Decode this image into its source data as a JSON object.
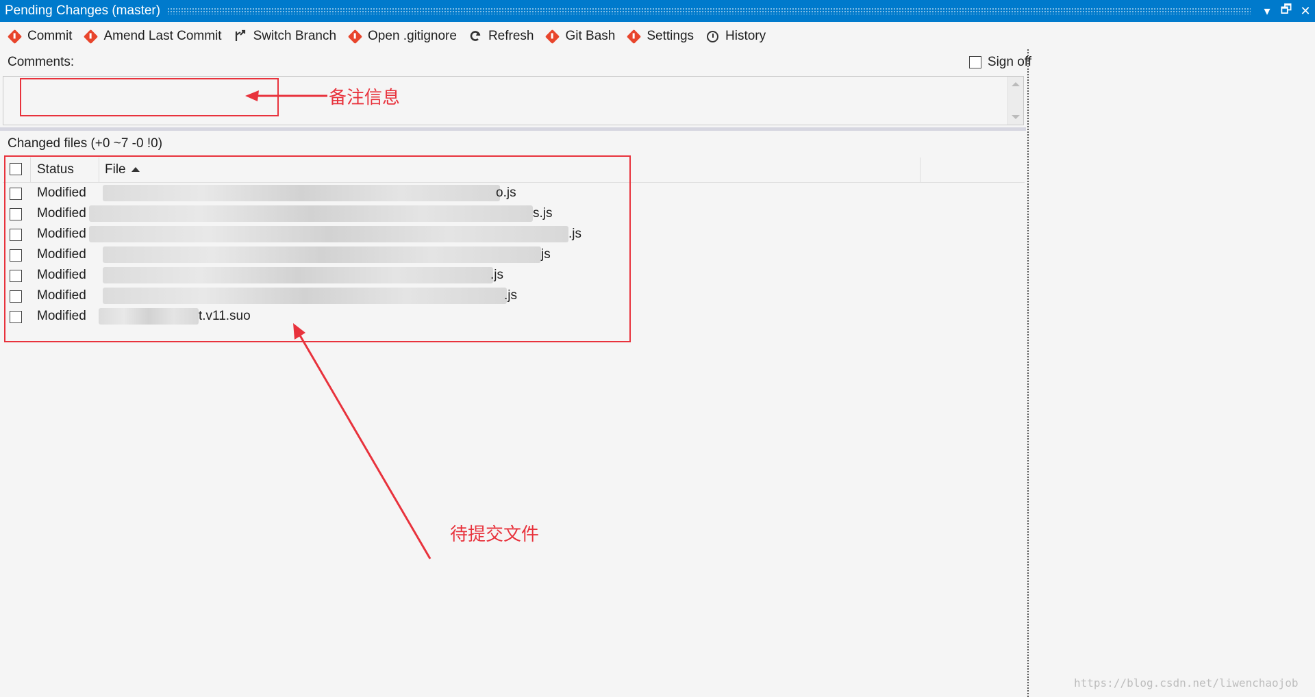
{
  "window": {
    "title": "Pending Changes (master)",
    "controls": [
      "▾",
      "🗗",
      "✕"
    ]
  },
  "toolbar": {
    "items": [
      {
        "label": "Commit",
        "icon": "git-commit-icon"
      },
      {
        "label": "Amend Last Commit",
        "icon": "git-amend-icon"
      },
      {
        "label": "Switch Branch",
        "icon": "branch-icon"
      },
      {
        "label": "Open .gitignore",
        "icon": "git-ignore-icon"
      },
      {
        "label": "Refresh",
        "icon": "refresh-icon"
      },
      {
        "label": "Git Bash",
        "icon": "git-bash-icon"
      },
      {
        "label": "Settings",
        "icon": "git-settings-icon"
      },
      {
        "label": "History",
        "icon": "history-icon"
      }
    ]
  },
  "comments": {
    "label": "Comments:",
    "sign_off": "Sign off",
    "value": ""
  },
  "changed_files": {
    "label": "Changed files (+0 ~7 -0 !0)",
    "columns": {
      "status": "Status",
      "file": "File"
    },
    "rows": [
      {
        "status": "Modified",
        "file": "o.js"
      },
      {
        "status": "Modified",
        "file": "s.js"
      },
      {
        "status": "Modified",
        "file": ".js"
      },
      {
        "status": "Modified",
        "file": "js"
      },
      {
        "status": "Modified",
        "file": ".js"
      },
      {
        "status": "Modified",
        "file": ".js"
      },
      {
        "status": "Modified",
        "file": "t.v11.suo"
      }
    ]
  },
  "annotations": {
    "comment_note": "备注信息",
    "files_note": "待提交文件"
  },
  "watermark": "https://blog.csdn.net/liwenchaojob",
  "colors": {
    "accent": "#007acc",
    "annotation_red": "#e8323c",
    "git_icon": "#e8452c"
  }
}
